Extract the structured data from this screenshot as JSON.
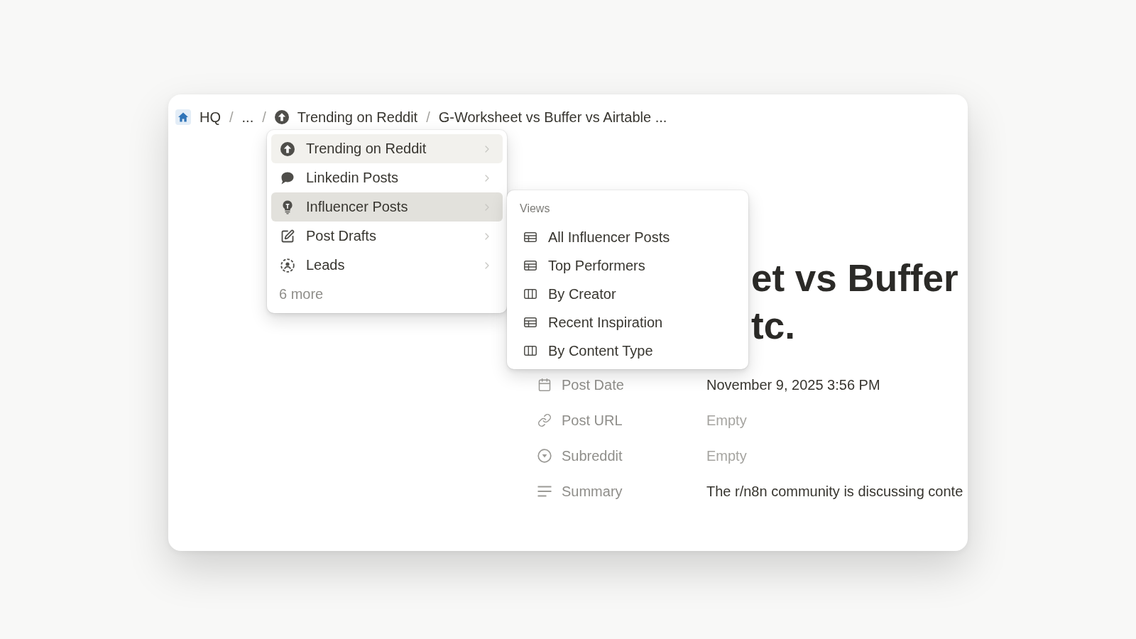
{
  "breadcrumb": [
    {
      "kind": "home",
      "label": "HQ"
    },
    {
      "kind": "separator",
      "label": "/"
    },
    {
      "kind": "ellipsis",
      "label": "..."
    },
    {
      "kind": "separator",
      "label": "/"
    },
    {
      "kind": "upvote",
      "label": "Trending on Reddit"
    },
    {
      "kind": "separator",
      "label": "/"
    },
    {
      "kind": "text",
      "label": "G-Worksheet vs Buffer vs Airtable ..."
    }
  ],
  "menu": {
    "items": [
      {
        "kind": "upvote",
        "label": "Trending on Reddit",
        "current": true,
        "selected": false
      },
      {
        "kind": "chat",
        "label": "Linkedin Posts",
        "current": false,
        "selected": false
      },
      {
        "kind": "bulb",
        "label": "Influencer Posts",
        "current": false,
        "selected": true
      },
      {
        "kind": "draft",
        "label": "Post Drafts",
        "current": false,
        "selected": false
      },
      {
        "kind": "lead",
        "label": "Leads",
        "current": false,
        "selected": false
      }
    ],
    "more": "6 more"
  },
  "submenu": {
    "heading": "Views",
    "items": [
      {
        "kind": "table",
        "label": "All Influencer Posts"
      },
      {
        "kind": "table",
        "label": "Top Performers"
      },
      {
        "kind": "board",
        "label": "By Creator"
      },
      {
        "kind": "table",
        "label": "Recent Inspiration"
      },
      {
        "kind": "board",
        "label": "By Content Type"
      }
    ]
  },
  "page": {
    "title_lines": [
      "et vs Buffer",
      "tc."
    ],
    "properties": [
      {
        "kind": "date",
        "label": "Post Date",
        "value": "November 9, 2025 3:56 PM",
        "empty": false
      },
      {
        "kind": "link",
        "label": "Post URL",
        "value": "Empty",
        "empty": true
      },
      {
        "kind": "select",
        "label": "Subreddit",
        "value": "Empty",
        "empty": true
      },
      {
        "kind": "text",
        "label": "Summary",
        "value": "The r/n8n community is discussing conte",
        "empty": false
      }
    ]
  }
}
